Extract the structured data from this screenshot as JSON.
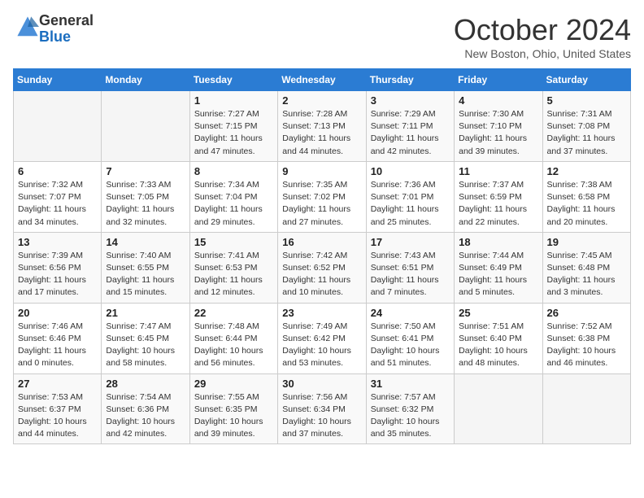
{
  "header": {
    "logo_line1": "General",
    "logo_line2": "Blue",
    "month_title": "October 2024",
    "location": "New Boston, Ohio, United States"
  },
  "weekdays": [
    "Sunday",
    "Monday",
    "Tuesday",
    "Wednesday",
    "Thursday",
    "Friday",
    "Saturday"
  ],
  "weeks": [
    [
      {
        "day": "",
        "info": ""
      },
      {
        "day": "",
        "info": ""
      },
      {
        "day": "1",
        "info": "Sunrise: 7:27 AM\nSunset: 7:15 PM\nDaylight: 11 hours\nand 47 minutes."
      },
      {
        "day": "2",
        "info": "Sunrise: 7:28 AM\nSunset: 7:13 PM\nDaylight: 11 hours\nand 44 minutes."
      },
      {
        "day": "3",
        "info": "Sunrise: 7:29 AM\nSunset: 7:11 PM\nDaylight: 11 hours\nand 42 minutes."
      },
      {
        "day": "4",
        "info": "Sunrise: 7:30 AM\nSunset: 7:10 PM\nDaylight: 11 hours\nand 39 minutes."
      },
      {
        "day": "5",
        "info": "Sunrise: 7:31 AM\nSunset: 7:08 PM\nDaylight: 11 hours\nand 37 minutes."
      }
    ],
    [
      {
        "day": "6",
        "info": "Sunrise: 7:32 AM\nSunset: 7:07 PM\nDaylight: 11 hours\nand 34 minutes."
      },
      {
        "day": "7",
        "info": "Sunrise: 7:33 AM\nSunset: 7:05 PM\nDaylight: 11 hours\nand 32 minutes."
      },
      {
        "day": "8",
        "info": "Sunrise: 7:34 AM\nSunset: 7:04 PM\nDaylight: 11 hours\nand 29 minutes."
      },
      {
        "day": "9",
        "info": "Sunrise: 7:35 AM\nSunset: 7:02 PM\nDaylight: 11 hours\nand 27 minutes."
      },
      {
        "day": "10",
        "info": "Sunrise: 7:36 AM\nSunset: 7:01 PM\nDaylight: 11 hours\nand 25 minutes."
      },
      {
        "day": "11",
        "info": "Sunrise: 7:37 AM\nSunset: 6:59 PM\nDaylight: 11 hours\nand 22 minutes."
      },
      {
        "day": "12",
        "info": "Sunrise: 7:38 AM\nSunset: 6:58 PM\nDaylight: 11 hours\nand 20 minutes."
      }
    ],
    [
      {
        "day": "13",
        "info": "Sunrise: 7:39 AM\nSunset: 6:56 PM\nDaylight: 11 hours\nand 17 minutes."
      },
      {
        "day": "14",
        "info": "Sunrise: 7:40 AM\nSunset: 6:55 PM\nDaylight: 11 hours\nand 15 minutes."
      },
      {
        "day": "15",
        "info": "Sunrise: 7:41 AM\nSunset: 6:53 PM\nDaylight: 11 hours\nand 12 minutes."
      },
      {
        "day": "16",
        "info": "Sunrise: 7:42 AM\nSunset: 6:52 PM\nDaylight: 11 hours\nand 10 minutes."
      },
      {
        "day": "17",
        "info": "Sunrise: 7:43 AM\nSunset: 6:51 PM\nDaylight: 11 hours\nand 7 minutes."
      },
      {
        "day": "18",
        "info": "Sunrise: 7:44 AM\nSunset: 6:49 PM\nDaylight: 11 hours\nand 5 minutes."
      },
      {
        "day": "19",
        "info": "Sunrise: 7:45 AM\nSunset: 6:48 PM\nDaylight: 11 hours\nand 3 minutes."
      }
    ],
    [
      {
        "day": "20",
        "info": "Sunrise: 7:46 AM\nSunset: 6:46 PM\nDaylight: 11 hours\nand 0 minutes."
      },
      {
        "day": "21",
        "info": "Sunrise: 7:47 AM\nSunset: 6:45 PM\nDaylight: 10 hours\nand 58 minutes."
      },
      {
        "day": "22",
        "info": "Sunrise: 7:48 AM\nSunset: 6:44 PM\nDaylight: 10 hours\nand 56 minutes."
      },
      {
        "day": "23",
        "info": "Sunrise: 7:49 AM\nSunset: 6:42 PM\nDaylight: 10 hours\nand 53 minutes."
      },
      {
        "day": "24",
        "info": "Sunrise: 7:50 AM\nSunset: 6:41 PM\nDaylight: 10 hours\nand 51 minutes."
      },
      {
        "day": "25",
        "info": "Sunrise: 7:51 AM\nSunset: 6:40 PM\nDaylight: 10 hours\nand 48 minutes."
      },
      {
        "day": "26",
        "info": "Sunrise: 7:52 AM\nSunset: 6:38 PM\nDaylight: 10 hours\nand 46 minutes."
      }
    ],
    [
      {
        "day": "27",
        "info": "Sunrise: 7:53 AM\nSunset: 6:37 PM\nDaylight: 10 hours\nand 44 minutes."
      },
      {
        "day": "28",
        "info": "Sunrise: 7:54 AM\nSunset: 6:36 PM\nDaylight: 10 hours\nand 42 minutes."
      },
      {
        "day": "29",
        "info": "Sunrise: 7:55 AM\nSunset: 6:35 PM\nDaylight: 10 hours\nand 39 minutes."
      },
      {
        "day": "30",
        "info": "Sunrise: 7:56 AM\nSunset: 6:34 PM\nDaylight: 10 hours\nand 37 minutes."
      },
      {
        "day": "31",
        "info": "Sunrise: 7:57 AM\nSunset: 6:32 PM\nDaylight: 10 hours\nand 35 minutes."
      },
      {
        "day": "",
        "info": ""
      },
      {
        "day": "",
        "info": ""
      }
    ]
  ]
}
